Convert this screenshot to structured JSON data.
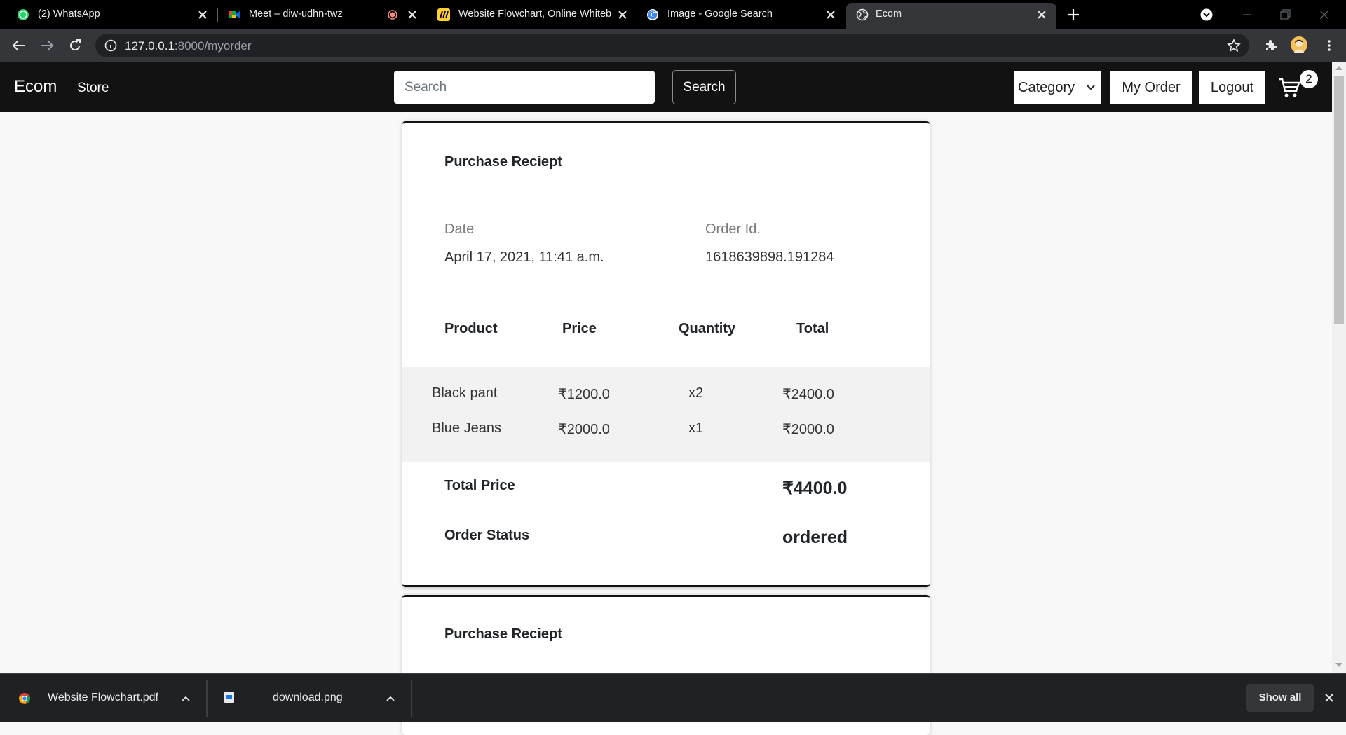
{
  "browser": {
    "tabs": [
      {
        "title": "(2) WhatsApp",
        "icon": "whatsapp-icon"
      },
      {
        "title": "Meet – diw-udhn-twz",
        "icon": "google-meet-icon"
      },
      {
        "title": "Website Flowchart, Online Whiteboard",
        "icon": "miro-icon"
      },
      {
        "title": "Image - Google Search",
        "icon": "google-icon"
      },
      {
        "title": "Ecom",
        "icon": "globe-icon",
        "active": true
      }
    ],
    "url_host": "127.0.0.1",
    "url_path": ":8000/myorder"
  },
  "navbar": {
    "brand": "Ecom",
    "store_link": "Store",
    "search_placeholder": "Search",
    "search_value": "",
    "search_button": "Search",
    "category_select": "Category",
    "my_order_button": "My Order",
    "logout_button": "Logout",
    "cart_count": "2"
  },
  "receipts": [
    {
      "title": "Purchase Reciept",
      "date_label": "Date",
      "date_value": "April 17, 2021, 11:41 a.m.",
      "order_id_label": "Order Id.",
      "order_id_value": "1618639898.191284",
      "columns": [
        "Product",
        "Price",
        "Quantity",
        "Total"
      ],
      "items": [
        {
          "product": "Black pant",
          "price": "₹1200.0",
          "quantity": "x2",
          "total": "₹2400.0"
        },
        {
          "product": "Blue Jeans",
          "price": "₹2000.0",
          "quantity": "x1",
          "total": "₹2000.0"
        }
      ],
      "total_price_label": "Total Price",
      "total_price_value": "₹4400.0",
      "order_status_label": "Order Status",
      "order_status_value": "ordered"
    },
    {
      "title": "Purchase Reciept"
    }
  ],
  "downloads": {
    "items": [
      {
        "filename": "Website Flowchart.pdf",
        "icon": "chrome-pdf-icon"
      },
      {
        "filename": "download.png",
        "icon": "image-file-icon"
      }
    ],
    "show_all": "Show all"
  },
  "colors": {
    "navbar_bg": "#121212",
    "page_bg": "#f8f8f8",
    "tab_strip_bg": "#000000",
    "toolbar_bg": "#35363a"
  }
}
